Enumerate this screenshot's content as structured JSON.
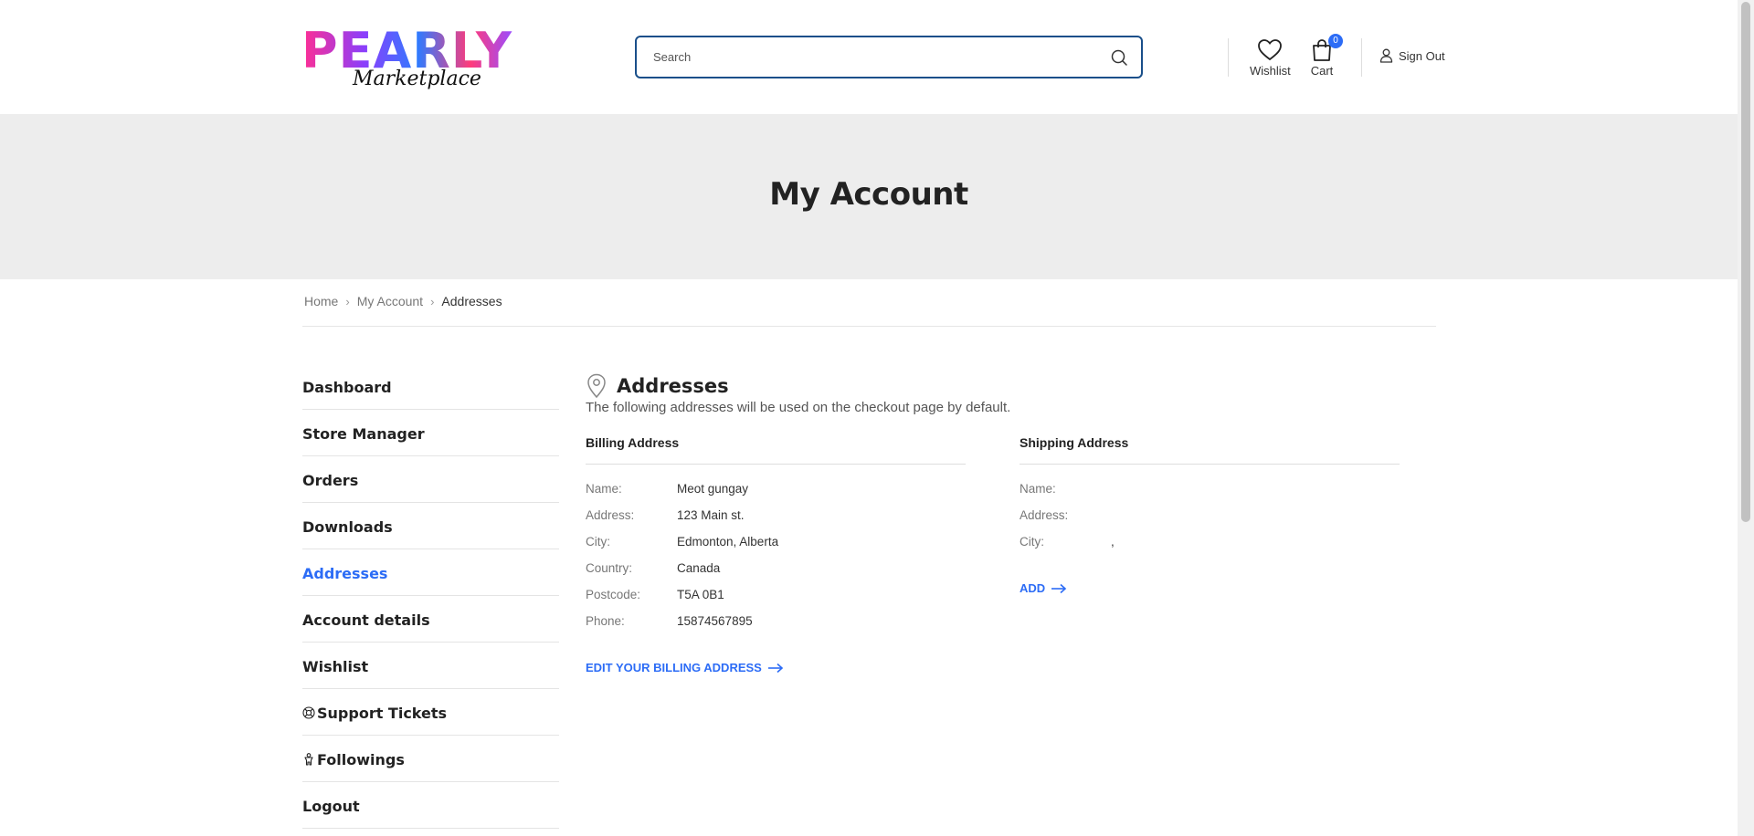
{
  "brand": {
    "logo_main": "PEARLY",
    "logo_sub": "Marketplace"
  },
  "header": {
    "search_placeholder": "Search",
    "wishlist_label": "Wishlist",
    "cart_label": "Cart",
    "cart_count": "0",
    "signout_label": "Sign Out"
  },
  "banner": {
    "title": "My Account"
  },
  "breadcrumb": {
    "home": "Home",
    "account": "My Account",
    "current": "Addresses",
    "separator": "›"
  },
  "sidebar": {
    "items": [
      {
        "label": "Dashboard"
      },
      {
        "label": "Store Manager"
      },
      {
        "label": "Orders"
      },
      {
        "label": "Downloads"
      },
      {
        "label": "Addresses"
      },
      {
        "label": "Account details"
      },
      {
        "label": "Wishlist"
      },
      {
        "label": "Support Tickets"
      },
      {
        "label": "Followings"
      },
      {
        "label": "Logout"
      }
    ],
    "active": "Addresses"
  },
  "main": {
    "title": "Addresses",
    "description": "The following addresses will be used on the checkout page by default.",
    "billing": {
      "heading": "Billing Address",
      "rows": [
        {
          "label": "Name:",
          "value": "Meot gungay"
        },
        {
          "label": "Address:",
          "value": "123 Main st."
        },
        {
          "label": "City:",
          "value": "Edmonton, Alberta"
        },
        {
          "label": "Country:",
          "value": "Canada"
        },
        {
          "label": "Postcode:",
          "value": "T5A 0B1"
        },
        {
          "label": "Phone:",
          "value": "15874567895"
        }
      ],
      "action": "EDIT YOUR BILLING ADDRESS"
    },
    "shipping": {
      "heading": "Shipping Address",
      "rows": [
        {
          "label": "Name:",
          "value": ""
        },
        {
          "label": "Address:",
          "value": ""
        },
        {
          "label": "City:",
          "value": ","
        }
      ],
      "action": "ADD"
    }
  },
  "colors": {
    "accent": "#2c6cf6",
    "banner_bg": "#ededed",
    "search_border": "#1a4f8a"
  }
}
